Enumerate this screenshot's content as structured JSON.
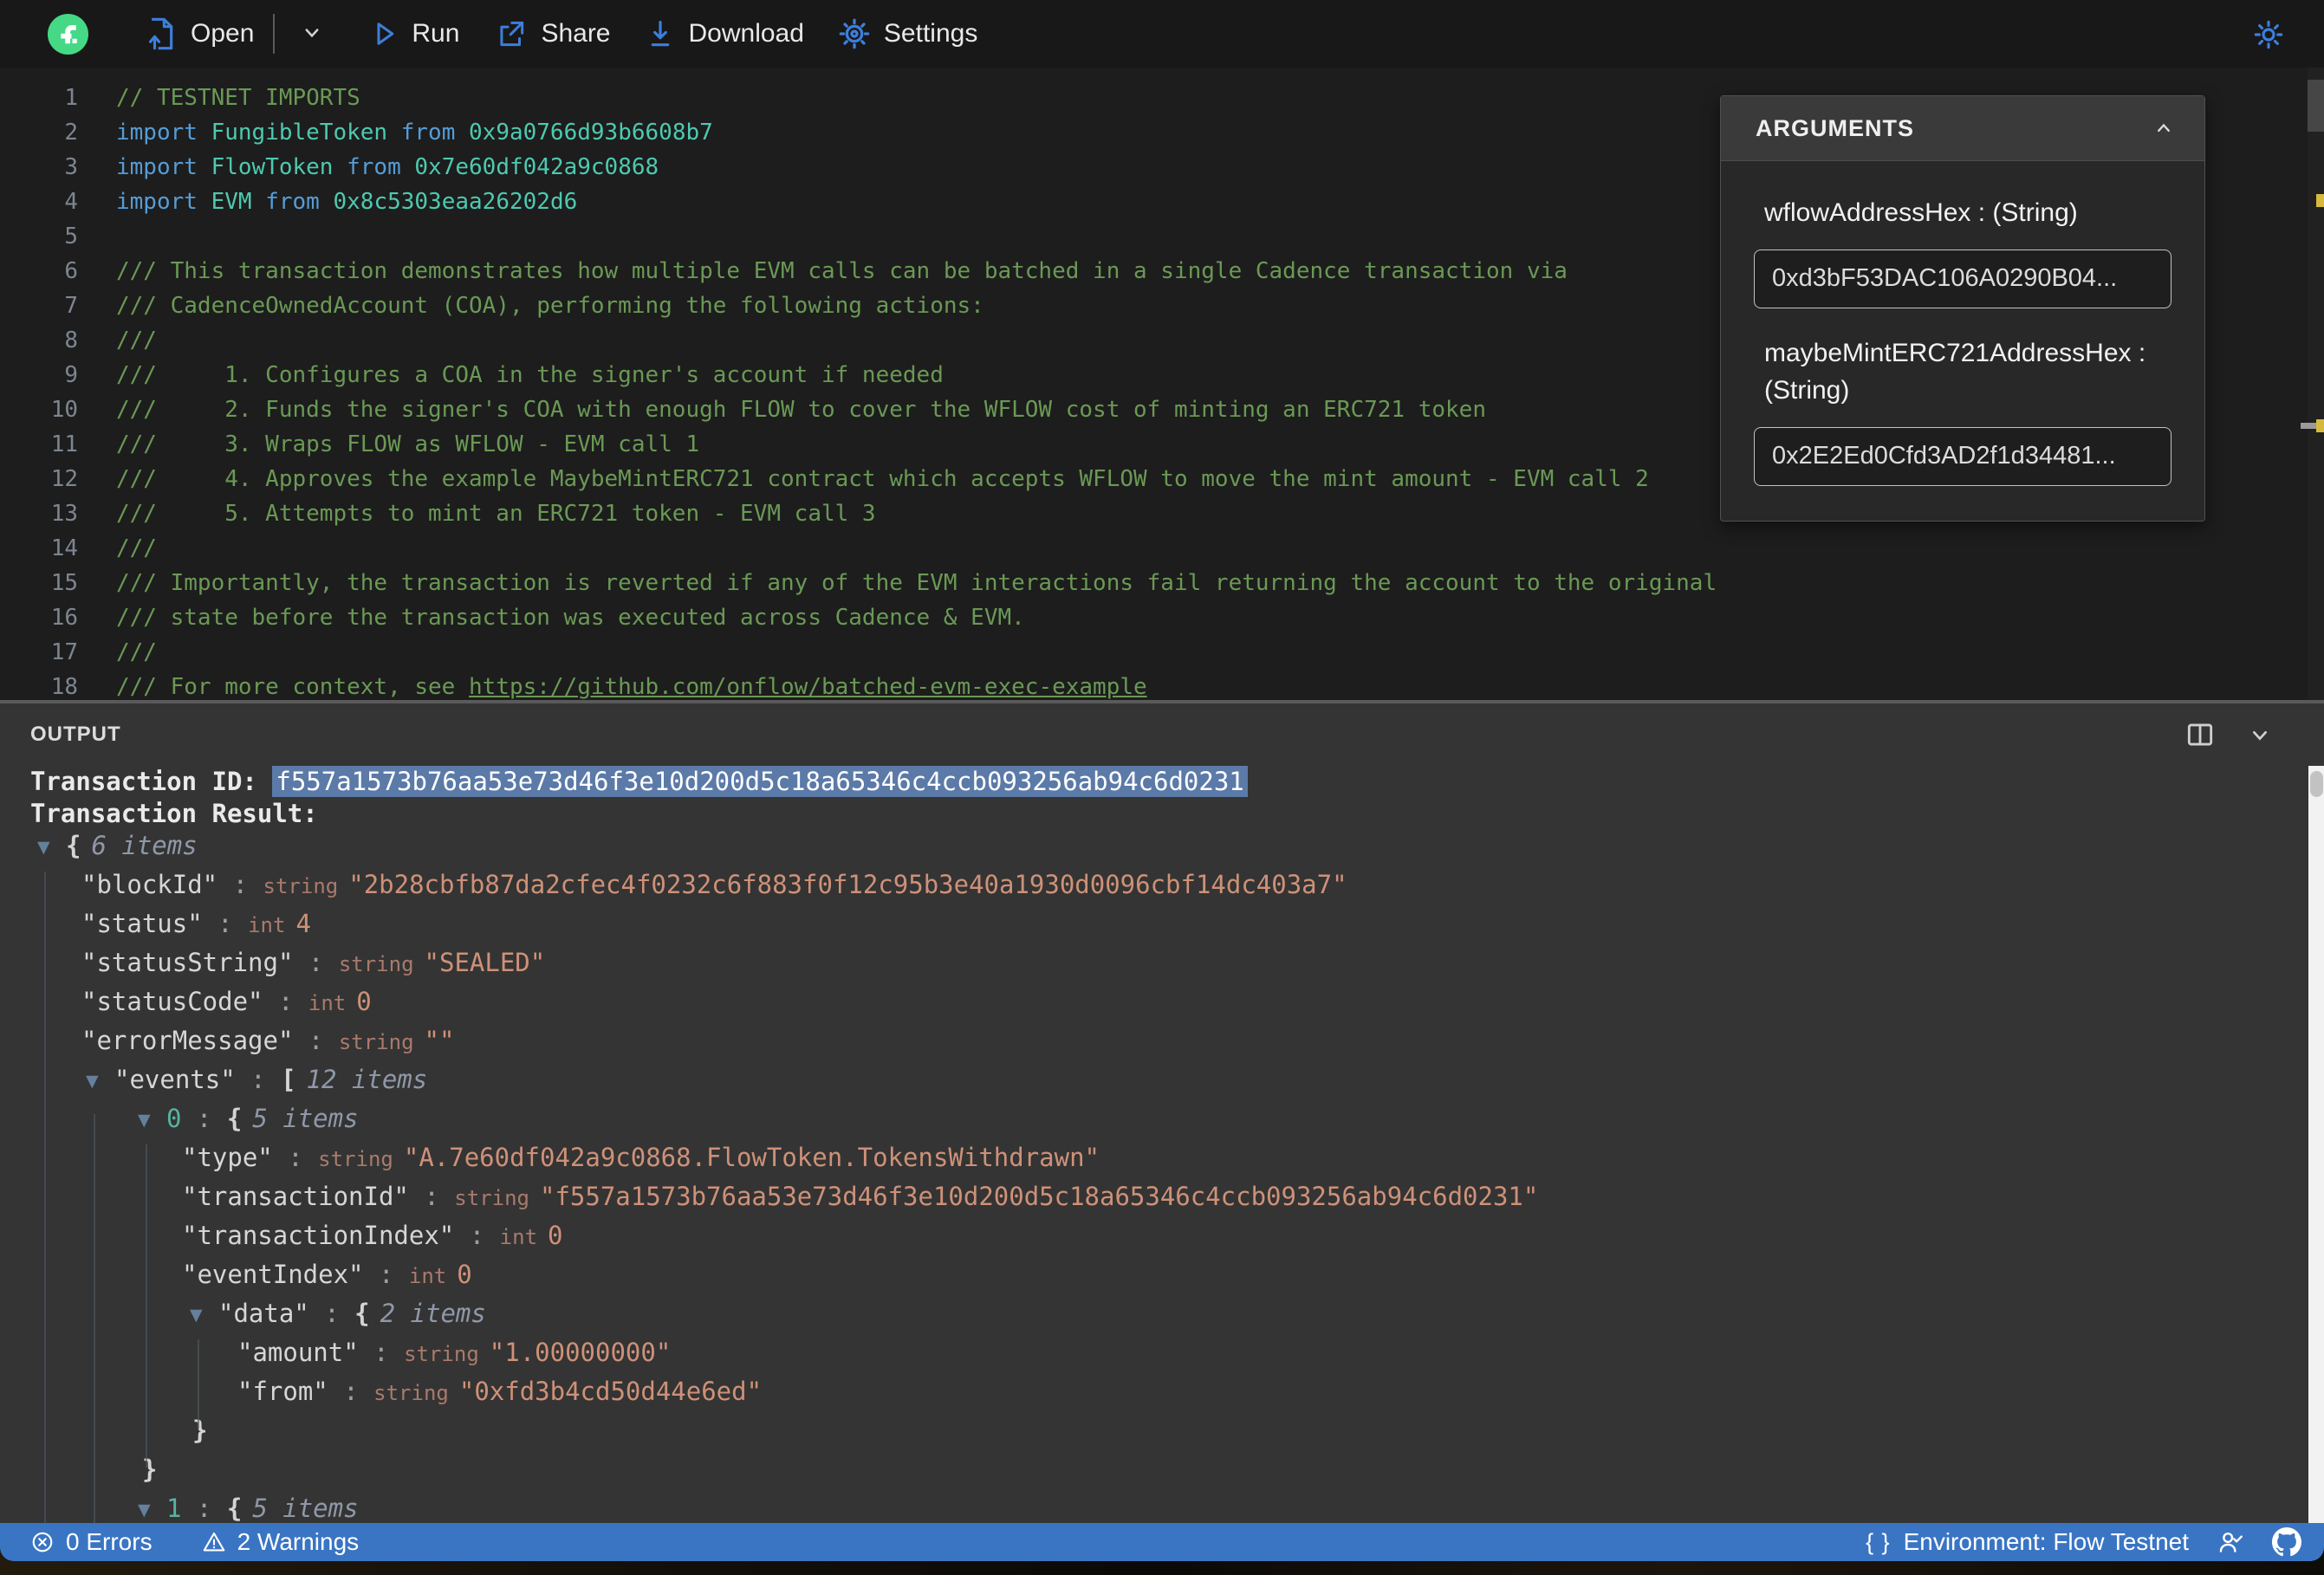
{
  "toolbar": {
    "open_label": "Open",
    "run_label": "Run",
    "share_label": "Share",
    "download_label": "Download",
    "settings_label": "Settings"
  },
  "arguments_panel": {
    "title": "ARGUMENTS",
    "fields": [
      {
        "label": "wflowAddressHex : (String)",
        "value": "0xd3bF53DAC106A0290B04..."
      },
      {
        "label": "maybeMintERC721AddressHex : (String)",
        "value": "0x2E2Ed0Cfd3AD2f1d34481..."
      }
    ]
  },
  "editor": {
    "lines": [
      {
        "n": "1",
        "t": [
          [
            "cmt",
            "// TESTNET IMPORTS"
          ]
        ]
      },
      {
        "n": "2",
        "t": [
          [
            "kw",
            "import "
          ],
          [
            "typ",
            "FungibleToken "
          ],
          [
            "kw",
            "from "
          ],
          [
            "typ",
            "0x9a0766d93b6608b7"
          ]
        ]
      },
      {
        "n": "3",
        "t": [
          [
            "kw",
            "import "
          ],
          [
            "typ",
            "FlowToken "
          ],
          [
            "kw",
            "from "
          ],
          [
            "typ",
            "0x7e60df042a9c0868"
          ]
        ]
      },
      {
        "n": "4",
        "t": [
          [
            "kw",
            "import "
          ],
          [
            "typ",
            "EVM "
          ],
          [
            "kw",
            "from "
          ],
          [
            "typ",
            "0x8c5303eaa26202d6"
          ]
        ]
      },
      {
        "n": "5",
        "t": []
      },
      {
        "n": "6",
        "t": [
          [
            "cmt",
            "/// This transaction demonstrates how multiple EVM calls can be batched in a single Cadence transaction via"
          ]
        ]
      },
      {
        "n": "7",
        "t": [
          [
            "cmt",
            "/// CadenceOwnedAccount (COA), performing the following actions:"
          ]
        ]
      },
      {
        "n": "8",
        "t": [
          [
            "cmt",
            "///"
          ]
        ]
      },
      {
        "n": "9",
        "t": [
          [
            "cmt",
            "///     1. Configures a COA in the signer's account if needed"
          ]
        ]
      },
      {
        "n": "10",
        "t": [
          [
            "cmt",
            "///     2. Funds the signer's COA with enough FLOW to cover the WFLOW cost of minting an ERC721 token"
          ]
        ]
      },
      {
        "n": "11",
        "t": [
          [
            "cmt",
            "///     3. Wraps FLOW as WFLOW - EVM call 1"
          ]
        ]
      },
      {
        "n": "12",
        "t": [
          [
            "cmt",
            "///     4. Approves the example MaybeMintERC721 contract which accepts WFLOW to move the mint amount - EVM call 2"
          ]
        ]
      },
      {
        "n": "13",
        "t": [
          [
            "cmt",
            "///     5. Attempts to mint an ERC721 token - EVM call 3"
          ]
        ]
      },
      {
        "n": "14",
        "t": [
          [
            "cmt",
            "///"
          ]
        ]
      },
      {
        "n": "15",
        "t": [
          [
            "cmt",
            "/// Importantly, the transaction is reverted if any of the EVM interactions fail returning the account to the original"
          ]
        ]
      },
      {
        "n": "16",
        "t": [
          [
            "cmt",
            "/// state before the transaction was executed across Cadence & EVM."
          ]
        ]
      },
      {
        "n": "17",
        "t": [
          [
            "cmt",
            "///"
          ]
        ]
      },
      {
        "n": "18",
        "t": [
          [
            "cmt",
            "/// For more context, see "
          ],
          [
            "lnk",
            "https://github.com/onflow/batched-evm-exec-example"
          ]
        ]
      }
    ]
  },
  "output": {
    "title": "OUTPUT",
    "tx_id_label": "Transaction ID: ",
    "tx_id_value": "f557a1573b76aa53e73d46f3e10d200d5c18a65346c4ccb093256ab94c6d0231",
    "tx_result_label": "Transaction Result:",
    "tree": [
      {
        "ind": 43,
        "t": [
          [
            "tri",
            "▼"
          ],
          [
            "punc",
            "{"
          ],
          [
            "items",
            "6 items"
          ]
        ]
      },
      {
        "ind": 94,
        "t": [
          [
            "key",
            "\"blockId\""
          ],
          [
            "colon",
            " : "
          ],
          [
            "type",
            "string"
          ],
          [
            "str",
            "\"2b28cbfb87da2cfec4f0232c6f883f0f12c95b3e40a1930d0096cbf14dc403a7\""
          ]
        ]
      },
      {
        "ind": 94,
        "t": [
          [
            "key",
            "\"status\""
          ],
          [
            "colon",
            " : "
          ],
          [
            "type",
            "int"
          ],
          [
            "int",
            "4"
          ]
        ]
      },
      {
        "ind": 94,
        "t": [
          [
            "key",
            "\"statusString\""
          ],
          [
            "colon",
            " : "
          ],
          [
            "type",
            "string"
          ],
          [
            "str",
            "\"SEALED\""
          ]
        ]
      },
      {
        "ind": 94,
        "t": [
          [
            "key",
            "\"statusCode\""
          ],
          [
            "colon",
            " : "
          ],
          [
            "type",
            "int"
          ],
          [
            "int",
            "0"
          ]
        ]
      },
      {
        "ind": 94,
        "t": [
          [
            "key",
            "\"errorMessage\""
          ],
          [
            "colon",
            " : "
          ],
          [
            "type",
            "string"
          ],
          [
            "str",
            "\"\""
          ]
        ]
      },
      {
        "ind": 99,
        "t": [
          [
            "tri",
            "▼"
          ],
          [
            "key",
            "\"events\""
          ],
          [
            "colon",
            " : "
          ],
          [
            "punc",
            "["
          ],
          [
            "items",
            "12 items"
          ]
        ]
      },
      {
        "ind": 159,
        "t": [
          [
            "tri",
            "▼"
          ],
          [
            "idx",
            "0"
          ],
          [
            "colon",
            " : "
          ],
          [
            "punc",
            "{"
          ],
          [
            "items",
            "5 items"
          ]
        ]
      },
      {
        "ind": 210,
        "t": [
          [
            "key",
            "\"type\""
          ],
          [
            "colon",
            " : "
          ],
          [
            "type",
            "string"
          ],
          [
            "str",
            "\"A.7e60df042a9c0868.FlowToken.TokensWithdrawn\""
          ]
        ]
      },
      {
        "ind": 210,
        "t": [
          [
            "key",
            "\"transactionId\""
          ],
          [
            "colon",
            " : "
          ],
          [
            "type",
            "string"
          ],
          [
            "str",
            "\"f557a1573b76aa53e73d46f3e10d200d5c18a65346c4ccb093256ab94c6d0231\""
          ]
        ]
      },
      {
        "ind": 210,
        "t": [
          [
            "key",
            "\"transactionIndex\""
          ],
          [
            "colon",
            " : "
          ],
          [
            "type",
            "int"
          ],
          [
            "int",
            "0"
          ]
        ]
      },
      {
        "ind": 210,
        "t": [
          [
            "key",
            "\"eventIndex\""
          ],
          [
            "colon",
            " : "
          ],
          [
            "type",
            "int"
          ],
          [
            "int",
            "0"
          ]
        ]
      },
      {
        "ind": 219,
        "t": [
          [
            "tri",
            "▼"
          ],
          [
            "key",
            "\"data\""
          ],
          [
            "colon",
            " : "
          ],
          [
            "punc",
            "{"
          ],
          [
            "items",
            "2 items"
          ]
        ]
      },
      {
        "ind": 274,
        "t": [
          [
            "key",
            "\"amount\""
          ],
          [
            "colon",
            " : "
          ],
          [
            "type",
            "string"
          ],
          [
            "str",
            "\"1.00000000\""
          ]
        ]
      },
      {
        "ind": 274,
        "t": [
          [
            "key",
            "\"from\""
          ],
          [
            "colon",
            " : "
          ],
          [
            "type",
            "string"
          ],
          [
            "str",
            "\"0xfd3b4cd50d44e6ed\""
          ]
        ]
      },
      {
        "ind": 222,
        "t": [
          [
            "punc",
            "}"
          ]
        ]
      },
      {
        "ind": 164,
        "t": [
          [
            "punc",
            "}"
          ]
        ]
      },
      {
        "ind": 159,
        "t": [
          [
            "tri",
            "▼"
          ],
          [
            "idx",
            "1"
          ],
          [
            "colon",
            " : "
          ],
          [
            "punc",
            "{"
          ],
          [
            "items",
            "5 items"
          ]
        ]
      }
    ]
  },
  "statusbar": {
    "errors_label": "0 Errors",
    "warnings_label": "2 Warnings",
    "environment_label": "Environment: Flow Testnet"
  },
  "colors": {
    "accent_blue": "#3d7edb",
    "flow_green": "#45d985",
    "statusbar_blue": "#3a75c4",
    "comment_green": "#6a9955",
    "keyword_blue": "#569cd6",
    "type_teal": "#4ec9b0",
    "string_orange": "#ce9178",
    "selection_blue": "#5b7aa8",
    "warning_yellow": "#d7ba3d"
  }
}
